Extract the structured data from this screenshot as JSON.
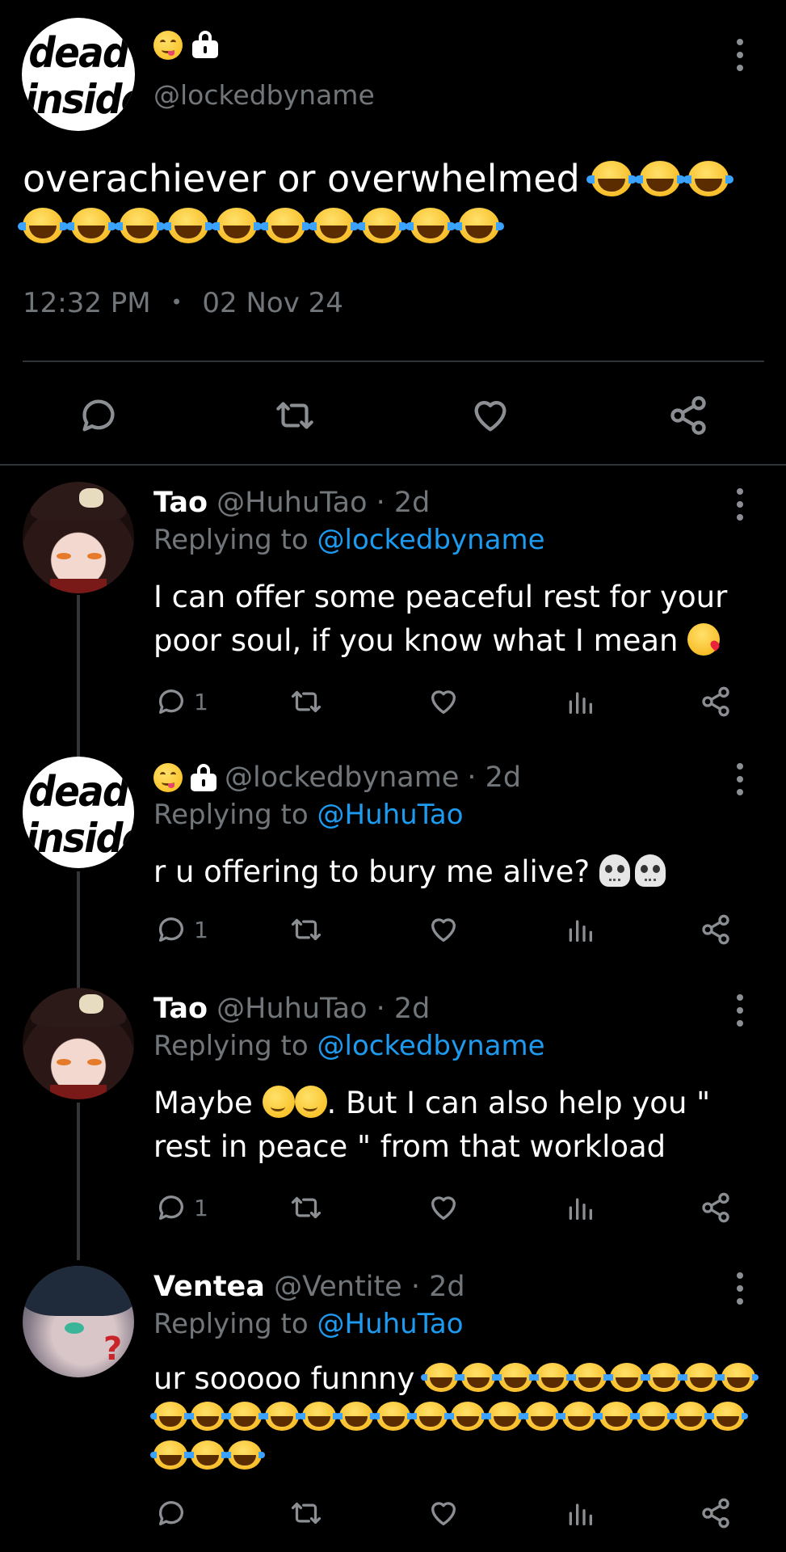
{
  "main_tweet": {
    "avatar_text_line1": "dead",
    "avatar_text_line2": "inside",
    "handle": "@lockedbyname",
    "text": "overachiever or overwhelmed",
    "laugh_count": 13,
    "time": "12:32 PM",
    "separator": "•",
    "date": "02 Nov 24",
    "badges": [
      "smile-tongue-icon",
      "lock-icon"
    ]
  },
  "replies": [
    {
      "name": "Tao",
      "handle": "@HuhuTao",
      "age": "· 2d",
      "replying_label": "Replying to",
      "replying_to": "@lockedbyname",
      "text": "I can offer some peaceful rest for your poor soul, if you know what I mean",
      "reply_count": "1"
    },
    {
      "name": "",
      "handle": "@lockedbyname",
      "age": "· 2d",
      "replying_label": "Replying to",
      "replying_to": "@HuhuTao",
      "text": "r u offering to bury me alive?",
      "reply_count": "1"
    },
    {
      "name": "Tao",
      "handle": "@HuhuTao",
      "age": "· 2d",
      "replying_label": "Replying to",
      "replying_to": "@lockedbyname",
      "text_part1": "Maybe",
      "text_part2": ". But I can also help you \" rest in peace \" from that workload",
      "reply_count": "1"
    },
    {
      "name": "Ventea",
      "handle": "@Ventite",
      "age": "· 2d",
      "replying_label": "Replying to",
      "replying_to": "@HuhuTao",
      "text": "ur sooooo funnny",
      "laugh_count": 28,
      "reply_count": ""
    }
  ],
  "colors": {
    "background": "#000000",
    "text": "#ffffff",
    "muted": "#71767b",
    "mention": "#1d9bf0",
    "divider": "#2f3336"
  }
}
